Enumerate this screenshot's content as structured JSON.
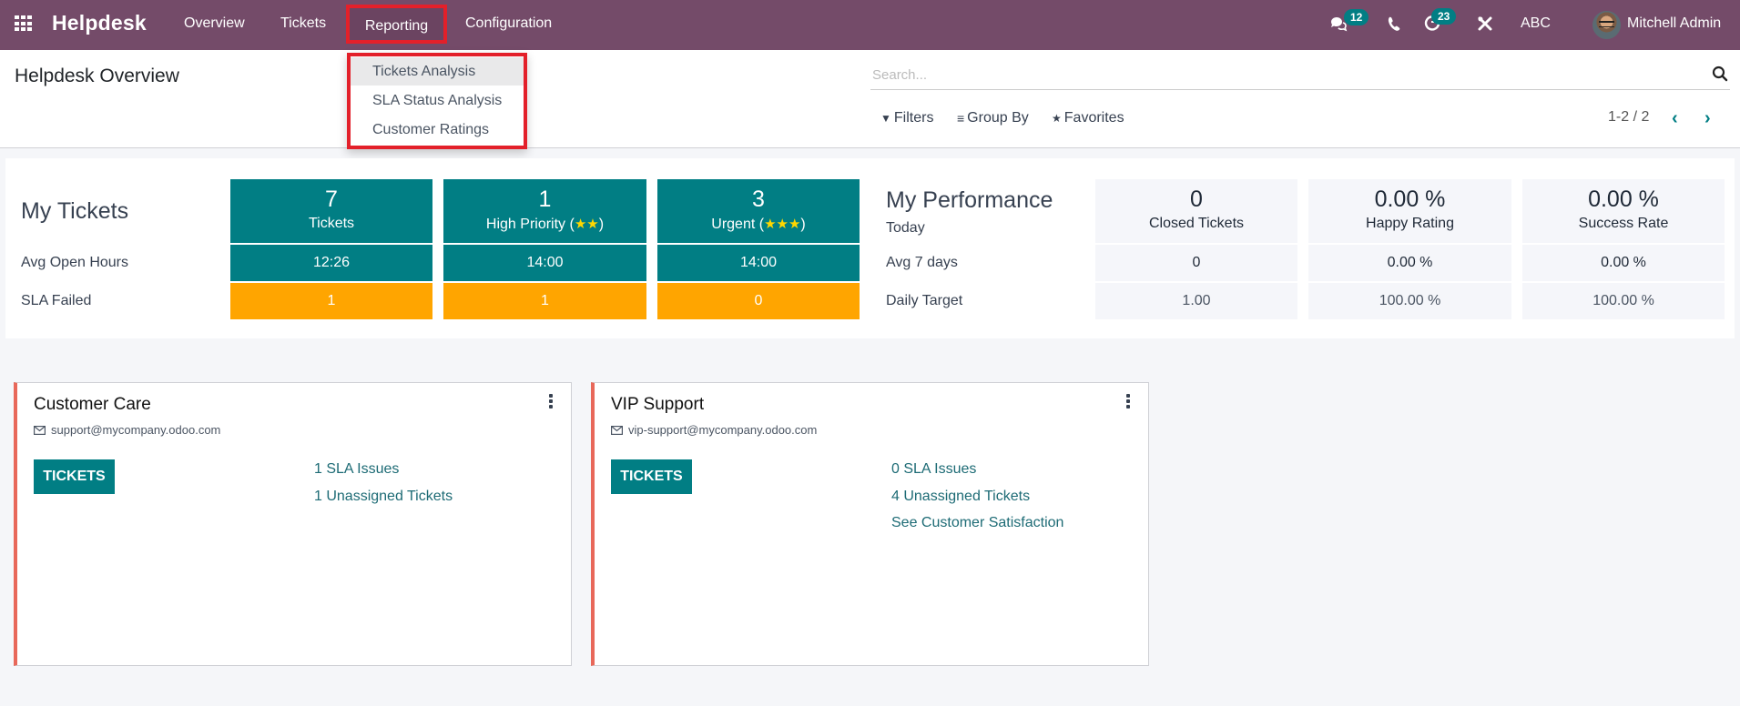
{
  "navbar": {
    "brand": "Helpdesk",
    "menu": [
      "Overview",
      "Tickets",
      "Reporting",
      "Configuration"
    ],
    "messages_badge": "12",
    "activities_badge": "23",
    "company": "ABC",
    "user": "Mitchell Admin",
    "bg_color": "#744b69"
  },
  "reporting_menu": {
    "items": [
      "Tickets Analysis",
      "SLA Status Analysis",
      "Customer Ratings"
    ],
    "highlight_color": "#e3202a"
  },
  "control_panel": {
    "title": "Helpdesk Overview",
    "search_placeholder": "Search...",
    "filters": "Filters",
    "group_by": "Group By",
    "favorites": "Favorites",
    "pager": "1-2 / 2"
  },
  "my_tickets": {
    "heading": "My Tickets",
    "row_labels": [
      "Avg Open Hours",
      "SLA Failed"
    ],
    "columns": [
      {
        "count": "7",
        "label": "Tickets",
        "stars": "",
        "avg_open_hours": "12:26",
        "sla_failed": "1"
      },
      {
        "count": "1",
        "label": "High Priority (",
        "stars": "★★",
        "label_end": ")",
        "avg_open_hours": "14:00",
        "sla_failed": "1"
      },
      {
        "count": "3",
        "label": "Urgent (",
        "stars": "★★★",
        "label_end": ")",
        "avg_open_hours": "14:00",
        "sla_failed": "0"
      }
    ],
    "teal_color": "#017e84",
    "orange_color": "#ffa500"
  },
  "my_performance": {
    "heading": "My Performance",
    "row_labels": [
      "Today",
      "Avg 7 days",
      "Daily Target"
    ],
    "columns": [
      {
        "today": "0",
        "label": "Closed Tickets",
        "avg_7_days": "0",
        "daily_target": "1.00"
      },
      {
        "today": "0.00 %",
        "label": "Happy Rating",
        "avg_7_days": "0.00 %",
        "daily_target": "100.00 %"
      },
      {
        "today": "0.00 %",
        "label": "Success Rate",
        "avg_7_days": "0.00 %",
        "daily_target": "100.00 %"
      }
    ]
  },
  "teams": [
    {
      "name": "Customer Care",
      "email": "support@mycompany.odoo.com",
      "button": "TICKETS",
      "links": [
        "1 SLA Issues",
        "1 Unassigned Tickets"
      ]
    },
    {
      "name": "VIP Support",
      "email": "vip-support@mycompany.odoo.com",
      "button": "TICKETS",
      "links": [
        "0 SLA Issues",
        "4 Unassigned Tickets",
        "See Customer Satisfaction"
      ]
    }
  ]
}
